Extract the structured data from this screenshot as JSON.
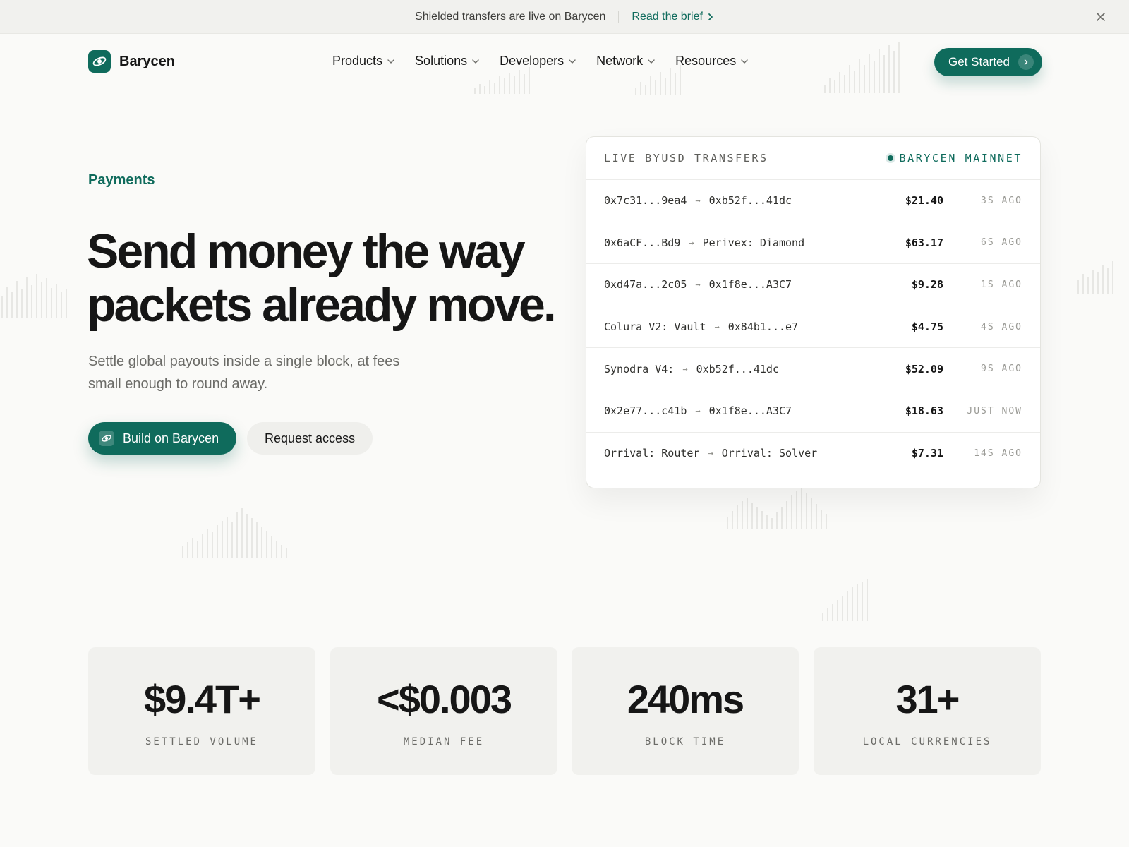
{
  "announcement": {
    "message": "Shielded transfers are live on Barycen",
    "link_label": "Read the brief"
  },
  "nav": {
    "brand": "Barycen",
    "menu": [
      "Products",
      "Solutions",
      "Developers",
      "Network",
      "Resources"
    ],
    "cta_label": "Get Started"
  },
  "hero": {
    "eyebrow": "Payments",
    "headline_line1": "Send money the way",
    "headline_line2": "packets already move.",
    "subtext": "Settle global payouts inside a single block, at fees small enough to round away.",
    "primary_button": "Build on Barycen",
    "secondary_button": "Request access"
  },
  "transfers": {
    "title": "LIVE BYUSD TRANSFERS",
    "network": "BARYCEN MAINNET",
    "rows": [
      {
        "from": "0x7c31...9ea4",
        "to": "0xb52f...41dc",
        "amount": "$21.40",
        "ago": "3S AGO"
      },
      {
        "from": "0x6aCF...Bd9",
        "to": "Perivex: Diamond",
        "amount": "$63.17",
        "ago": "6S AGO"
      },
      {
        "from": "0xd47a...2c05",
        "to": "0x1f8e...A3C7",
        "amount": "$9.28",
        "ago": "1S AGO"
      },
      {
        "from": "Colura V2: Vault",
        "to": "0x84b1...e7",
        "amount": "$4.75",
        "ago": "4S AGO"
      },
      {
        "from": "Synodra V4:",
        "to": "0xb52f...41dc",
        "amount": "$52.09",
        "ago": "9S AGO"
      },
      {
        "from": "0x2e77...c41b",
        "to": "0x1f8e...A3C7",
        "amount": "$18.63",
        "ago": "JUST NOW"
      },
      {
        "from": "Orrival: Router",
        "to": "Orrival: Solver",
        "amount": "$7.31",
        "ago": "14S AGO"
      }
    ]
  },
  "stats": [
    {
      "value": "$9.4T+",
      "label": "SETTLED VOLUME"
    },
    {
      "value": "<$0.003",
      "label": "MEDIAN FEE"
    },
    {
      "value": "240ms",
      "label": "BLOCK TIME"
    },
    {
      "value": "31+",
      "label": "LOCAL CURRENCIES"
    }
  ],
  "colors": {
    "accent": "#0f6b5c",
    "background": "#fafaf8",
    "card_muted": "#f1f1ee"
  },
  "icons": {
    "announcement_link": "chevron-right-icon",
    "close": "close-icon",
    "brand": "planet-orbit-logo",
    "menu": "chevron-down-icon",
    "cta": "chevron-right-icon",
    "primary_button": "planet-orbit-icon",
    "transfer_route": "right-arrow-icon",
    "network_status": "status-dot-icon"
  }
}
